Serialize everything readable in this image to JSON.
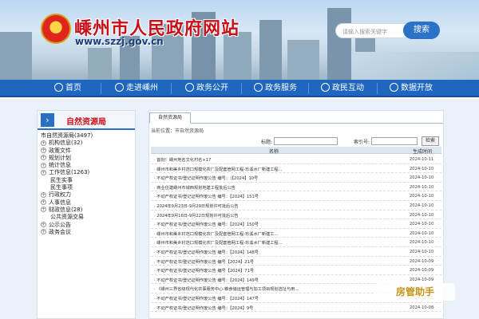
{
  "header": {
    "emblem_char": "☆",
    "title": "嵊州市人民政府网站",
    "url": "www.szzj.gov.cn",
    "search_placeholder": "请输入搜索关键字",
    "search_button": "搜索"
  },
  "nav": {
    "items": [
      "首页",
      "走进嵊州",
      "政务公开",
      "政务服务",
      "政民互动",
      "数据开放"
    ]
  },
  "sidebar": {
    "arrow": "›",
    "title": "自然资源局",
    "tree": [
      {
        "label": "市自然资源局(3497)",
        "level": "root",
        "plus": false
      },
      {
        "label": "机构信息(32)",
        "level": "l1",
        "plus": true
      },
      {
        "label": "政策文件",
        "level": "l1",
        "plus": true
      },
      {
        "label": "规划计划",
        "level": "l1",
        "plus": true
      },
      {
        "label": "统计信息",
        "level": "l1",
        "plus": true
      },
      {
        "label": "工作信息(1263)",
        "level": "l1",
        "plus": true
      },
      {
        "label": "民生实事",
        "level": "l2",
        "plus": false
      },
      {
        "label": "民生事项",
        "level": "l2",
        "plus": false
      },
      {
        "label": "行政权力",
        "level": "l1",
        "plus": true
      },
      {
        "label": "人事信息",
        "level": "l1",
        "plus": true
      },
      {
        "label": "财政信息(28)",
        "level": "l1",
        "plus": true
      },
      {
        "label": "公共资源交易",
        "level": "l2",
        "plus": false
      },
      {
        "label": "公示公告",
        "level": "l1",
        "plus": true
      },
      {
        "label": "政务会议",
        "level": "l1",
        "plus": true
      }
    ]
  },
  "main": {
    "tab": "自然资源局",
    "breadcrumb": "当前位置：市自然资源局",
    "filter": {
      "title_label": "标题:",
      "index_label": "索引号:",
      "search_button": "检索"
    },
    "columns": {
      "name": "名称",
      "date": "生成时间"
    },
    "rows": [
      {
        "title": "· 首批！嵊州地名文化村名+17",
        "date": "2024-10-11"
      },
      {
        "title": "· 嵊州市和美乡村范口规模化农厂及配套管网工程-珍溪水厂新建工程...",
        "date": "2024-10-10"
      },
      {
        "title": "· 不动产权证书/登记证明作废公告 编号：（【2024】10号",
        "date": "2024-10-10"
      },
      {
        "title": "· 商业住建嵊州市城西规划地建工程批后公告",
        "date": "2024-10-10"
      },
      {
        "title": "· 不动产权证书/登记证明作废公告 编号：【2024】151号",
        "date": "2024-10-10"
      },
      {
        "title": "· 2024年9月23日-9月29日规划许可批后公告",
        "date": "2024-10-10"
      },
      {
        "title": "· 2024年9月16日-9月22日规划许可批后公告",
        "date": "2024-10-10"
      },
      {
        "title": "· 不动产权证书/登记证明作废公告 编号：【2024】150号",
        "date": "2024-10-10"
      },
      {
        "title": "· 嵊州市和美乡村范口规模化农厂及配套管网工程-珍溪水厂新建工...",
        "date": "2024-10-10"
      },
      {
        "title": "· 嵊州市和美乡村范口规模化农厂及配套管网工程-珍溪水厂新建工程...",
        "date": "2024-10-10"
      },
      {
        "title": "· 不动产权证书/登记证明作废公告 编号：【2024】148号",
        "date": "2024-10-10"
      },
      {
        "title": "· 不动产权证书/登记证明作废公告 编号【2024】21号",
        "date": "2024-10-09"
      },
      {
        "title": "· 不动产权证书/登记证明作废公告 编号【2024】71号",
        "date": "2024-10-09"
      },
      {
        "title": "· 不动产权证书/登记证明作废公告 编号：【2024】149号",
        "date": "2024-10-09"
      },
      {
        "title": "· 《嵊州三界省级现代化农事服务中心-粮食储运管理与加工项目规划选址与用...",
        "date": "2024-10-09"
      },
      {
        "title": "· 不动产权证书/登记证明作废公告 编号：【2024】147号",
        "date": "2024-10-09"
      },
      {
        "title": "· 不动产权证书/登记证明作废公告 编号：【2024】9号",
        "date": "2024-10-08"
      }
    ]
  },
  "watermark": "房管助手"
}
